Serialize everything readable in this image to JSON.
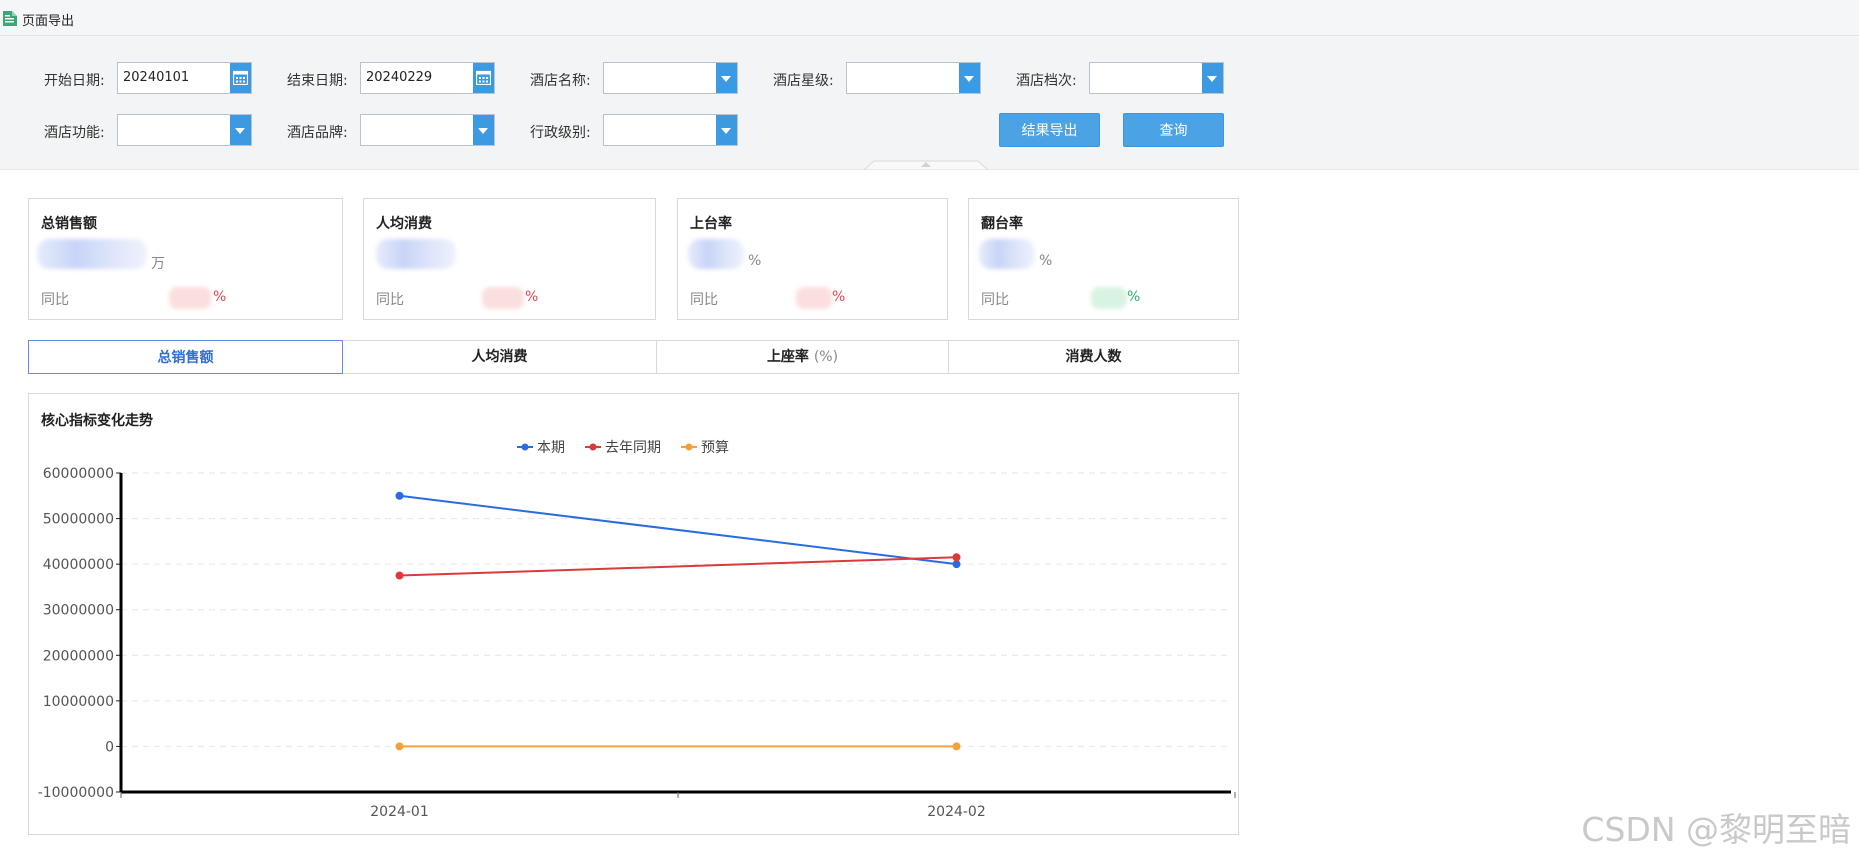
{
  "titlebar": {
    "title": "页面导出",
    "icon": "document-icon"
  },
  "filters": {
    "start_date": {
      "label": "开始日期:",
      "value": "20240101"
    },
    "end_date": {
      "label": "结束日期:",
      "value": "20240229"
    },
    "hotel_name": {
      "label": "酒店名称:",
      "value": ""
    },
    "hotel_star": {
      "label": "酒店星级:",
      "value": ""
    },
    "hotel_tier": {
      "label": "酒店档次:",
      "value": ""
    },
    "hotel_function": {
      "label": "酒店功能:",
      "value": ""
    },
    "hotel_brand": {
      "label": "酒店品牌:",
      "value": ""
    },
    "admin_level": {
      "label": "行政级别:",
      "value": ""
    },
    "export_button": "结果导出",
    "query_button": "查询"
  },
  "cards": [
    {
      "title": "总销售额",
      "unit": "万",
      "yoy_label": "同比",
      "yoy_pct": "%",
      "yoy_color": "#e0464e"
    },
    {
      "title": "人均消费",
      "unit": "",
      "yoy_label": "同比",
      "yoy_pct": "%",
      "yoy_color": "#e0464e"
    },
    {
      "title": "上台率",
      "unit": "%",
      "yoy_label": "同比",
      "yoy_pct": "%",
      "yoy_color": "#e0464e"
    },
    {
      "title": "翻台率",
      "unit": "%",
      "yoy_label": "同比",
      "yoy_pct": "%",
      "yoy_color": "#2db46c"
    }
  ],
  "tabs": [
    {
      "label": "总销售额",
      "suffix": ""
    },
    {
      "label": "人均消费",
      "suffix": ""
    },
    {
      "label": "上座率 ",
      "suffix": "(%)"
    },
    {
      "label": "消费人数",
      "suffix": ""
    }
  ],
  "chart": {
    "title": "核心指标变化走势"
  },
  "chart_data": {
    "type": "line",
    "title": "核心指标变化走势",
    "categories": [
      "2024-01",
      "2024-02"
    ],
    "series": [
      {
        "name": "本期",
        "color": "#2b6be0",
        "values": [
          55000000,
          40000000
        ]
      },
      {
        "name": "去年同期",
        "color": "#d93a3a",
        "values": [
          37500000,
          41500000
        ]
      },
      {
        "name": "预算",
        "color": "#f5a13b",
        "values": [
          0,
          0
        ]
      }
    ],
    "ylim": [
      -10000000,
      60000000
    ],
    "yticks": [
      "60000000",
      "50000000",
      "40000000",
      "30000000",
      "20000000",
      "10000000",
      "0",
      "-10000000"
    ],
    "grid": true,
    "legend_position": "top-center"
  },
  "watermark": "CSDN @黎明至暗"
}
